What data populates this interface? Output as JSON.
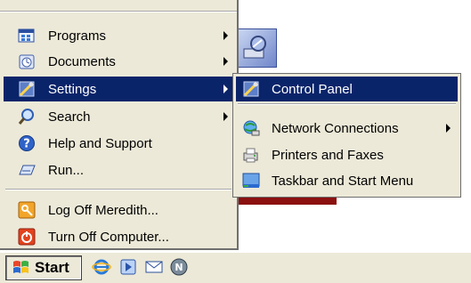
{
  "start_menu": {
    "items": [
      {
        "label": "Programs",
        "icon": "programs-icon",
        "submenu": true
      },
      {
        "label": "Documents",
        "icon": "documents-icon",
        "submenu": true
      },
      {
        "label": "Settings",
        "icon": "settings-icon",
        "submenu": true,
        "highlighted": true
      },
      {
        "label": "Search",
        "icon": "search-icon",
        "submenu": true
      },
      {
        "label": "Help and Support",
        "icon": "help-icon",
        "submenu": false
      },
      {
        "label": "Run...",
        "icon": "run-icon",
        "submenu": false
      },
      {
        "label": "Log Off Meredith...",
        "icon": "log-off-icon",
        "submenu": false
      },
      {
        "label": "Turn Off Computer...",
        "icon": "turn-off-icon",
        "submenu": false
      }
    ]
  },
  "settings_submenu": {
    "items": [
      {
        "label": "Control Panel",
        "icon": "control-panel-icon",
        "highlighted": true
      },
      {
        "label": "Network Connections",
        "icon": "network-connections-icon",
        "submenu": true
      },
      {
        "label": "Printers and Faxes",
        "icon": "printers-icon"
      },
      {
        "label": "Taskbar and Start Menu",
        "icon": "taskbar-icon"
      }
    ]
  },
  "taskbar": {
    "start_label": "Start",
    "quick_launch": [
      "internet-explorer-icon",
      "media-icon",
      "email-icon",
      "netscape-icon"
    ]
  },
  "colors": {
    "menu_bg": "#ece9d8",
    "highlight": "#0a246a",
    "highlight_text": "#ffffff"
  }
}
